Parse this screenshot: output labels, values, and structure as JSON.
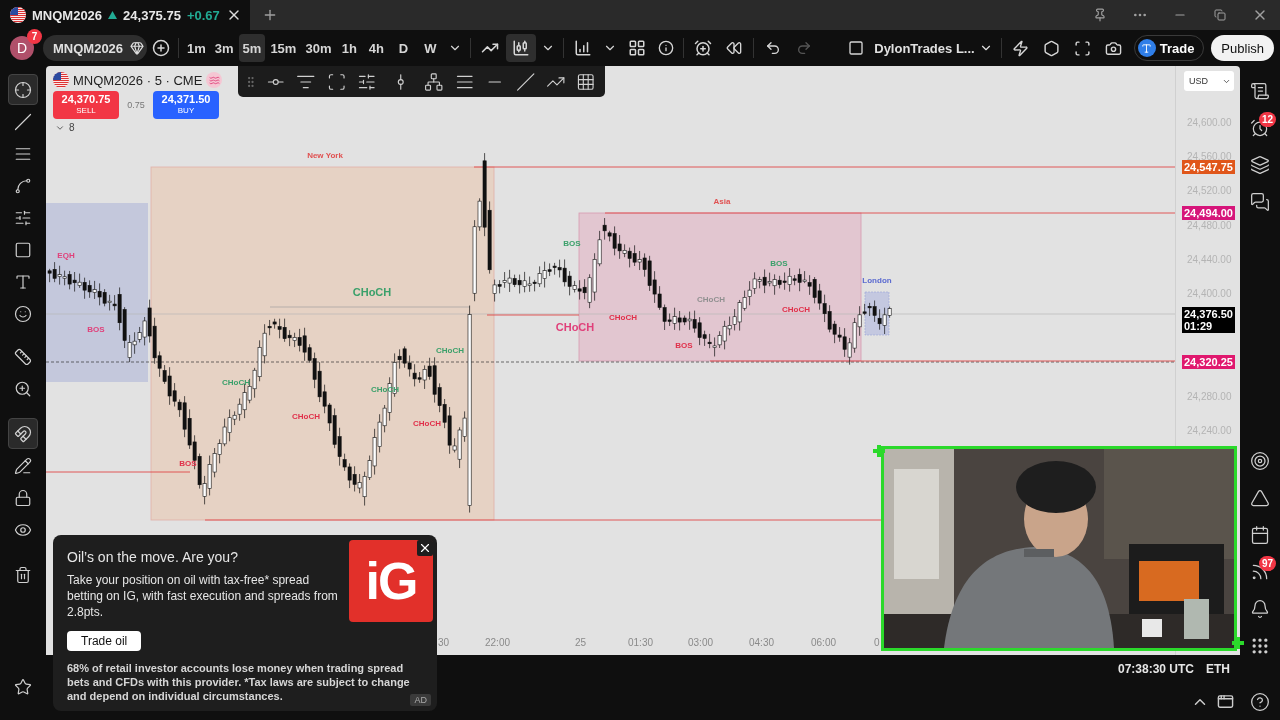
{
  "tab": {
    "symbol": "MNQM2026",
    "rising": true,
    "price": "24,375.75",
    "change": "+0.67"
  },
  "toolbar": {
    "avatar": "D",
    "avatar_badge": "7",
    "symbol": "MNQM2026",
    "intervals": [
      {
        "label": "1m",
        "selected": false
      },
      {
        "label": "3m",
        "selected": false
      },
      {
        "label": "5m",
        "selected": true
      },
      {
        "label": "15m",
        "selected": false
      },
      {
        "label": "30m",
        "selected": false
      },
      {
        "label": "1h",
        "selected": false
      },
      {
        "label": "4h",
        "selected": false
      },
      {
        "label": "D",
        "selected": false
      },
      {
        "label": "W",
        "selected": false
      }
    ],
    "candles_selected": true,
    "layout_name": "DylonTrades L...",
    "trade": "Trade",
    "publish": "Publish"
  },
  "left_tools": [
    {
      "selected": true
    },
    {
      "selected": false
    },
    {
      "selected": false
    },
    {
      "selected": false
    },
    {
      "selected": false
    },
    {
      "selected": false
    },
    {
      "selected": false
    },
    {
      "selected": false
    },
    {
      "selected": false
    },
    {
      "selected": false
    },
    {
      "selected": true
    },
    {
      "selected": false
    },
    {
      "selected": false
    },
    {
      "selected": false
    },
    {
      "selected": false
    }
  ],
  "chart": {
    "legend": "MNQM2026 · 5 · CME",
    "sell": {
      "price": "24,370.75",
      "label": "SELL"
    },
    "spread": "0.75",
    "buy": {
      "price": "24,371.50",
      "label": "BUY"
    },
    "indicators_count": "8",
    "currency": "USD",
    "price_ticks": [
      "24,600.00",
      "24,560.00",
      "24,520.00",
      "24,480.00",
      "24,440.00",
      "24,400.00",
      "24,280.00",
      "24,240.00"
    ],
    "price_badges": [
      {
        "price": "24,547.75",
        "color": "#e0561a"
      },
      {
        "price": "24,494.00",
        "color": "#d6157a"
      },
      {
        "price": "24,376.50",
        "timer": "01:29",
        "color": "#000000"
      },
      {
        "price": "24,320.25",
        "color": "#e0186e"
      }
    ],
    "time_ticks": [
      "30",
      "22:00",
      "25",
      "01:30",
      "03:00",
      "04:30",
      "06:00",
      "0"
    ],
    "annotations": [
      {
        "text": "New York",
        "color": "#e05050"
      },
      {
        "text": "EQH",
        "color": "#e0407a"
      },
      {
        "text": "BOS",
        "color": "#e0407a"
      },
      {
        "text": "CHoCH",
        "color": "#3aa06a"
      },
      {
        "text": "CHoCH",
        "color": "#3aa06a"
      },
      {
        "text": "CHoCH",
        "color": "#e0304a"
      },
      {
        "text": "CHoCH",
        "color": "#3aa06a"
      },
      {
        "text": "CHoCH",
        "color": "#3aa06a"
      },
      {
        "text": "CHoCH",
        "color": "#e0304a"
      },
      {
        "text": "BOS",
        "color": "#e0304a"
      },
      {
        "text": "Asia",
        "color": "#e05050"
      },
      {
        "text": "BOS",
        "color": "#3aa06a"
      },
      {
        "text": "CHoCH",
        "color": "#e0407a"
      },
      {
        "text": "CHoCH",
        "color": "#e0304a"
      },
      {
        "text": "CHoCH",
        "color": "#909090"
      },
      {
        "text": "BOS",
        "color": "#e0304a"
      },
      {
        "text": "BOS",
        "color": "#3aa06a"
      },
      {
        "text": "CHoCH",
        "color": "#e0304a"
      },
      {
        "text": "London",
        "color": "#5a6ad0"
      }
    ]
  },
  "status": {
    "time": "07:38:30 UTC",
    "session": "ETH"
  },
  "right_bar": {
    "alerts_badge": "12",
    "notifications_badge": "97"
  },
  "ad": {
    "title": "Oil’s on the move. Are you?",
    "body": "Take your position on oil with tax-free* spread betting on IG, with fast execution and spreads from 2.8pts.",
    "button": "Trade oil",
    "disclaimer": "68% of retail investor accounts lose money when trading spread bets and CFDs with this provider. *Tax laws are subject to change and depend on individual circumstances.",
    "logo": "iG",
    "tag": "AD"
  }
}
